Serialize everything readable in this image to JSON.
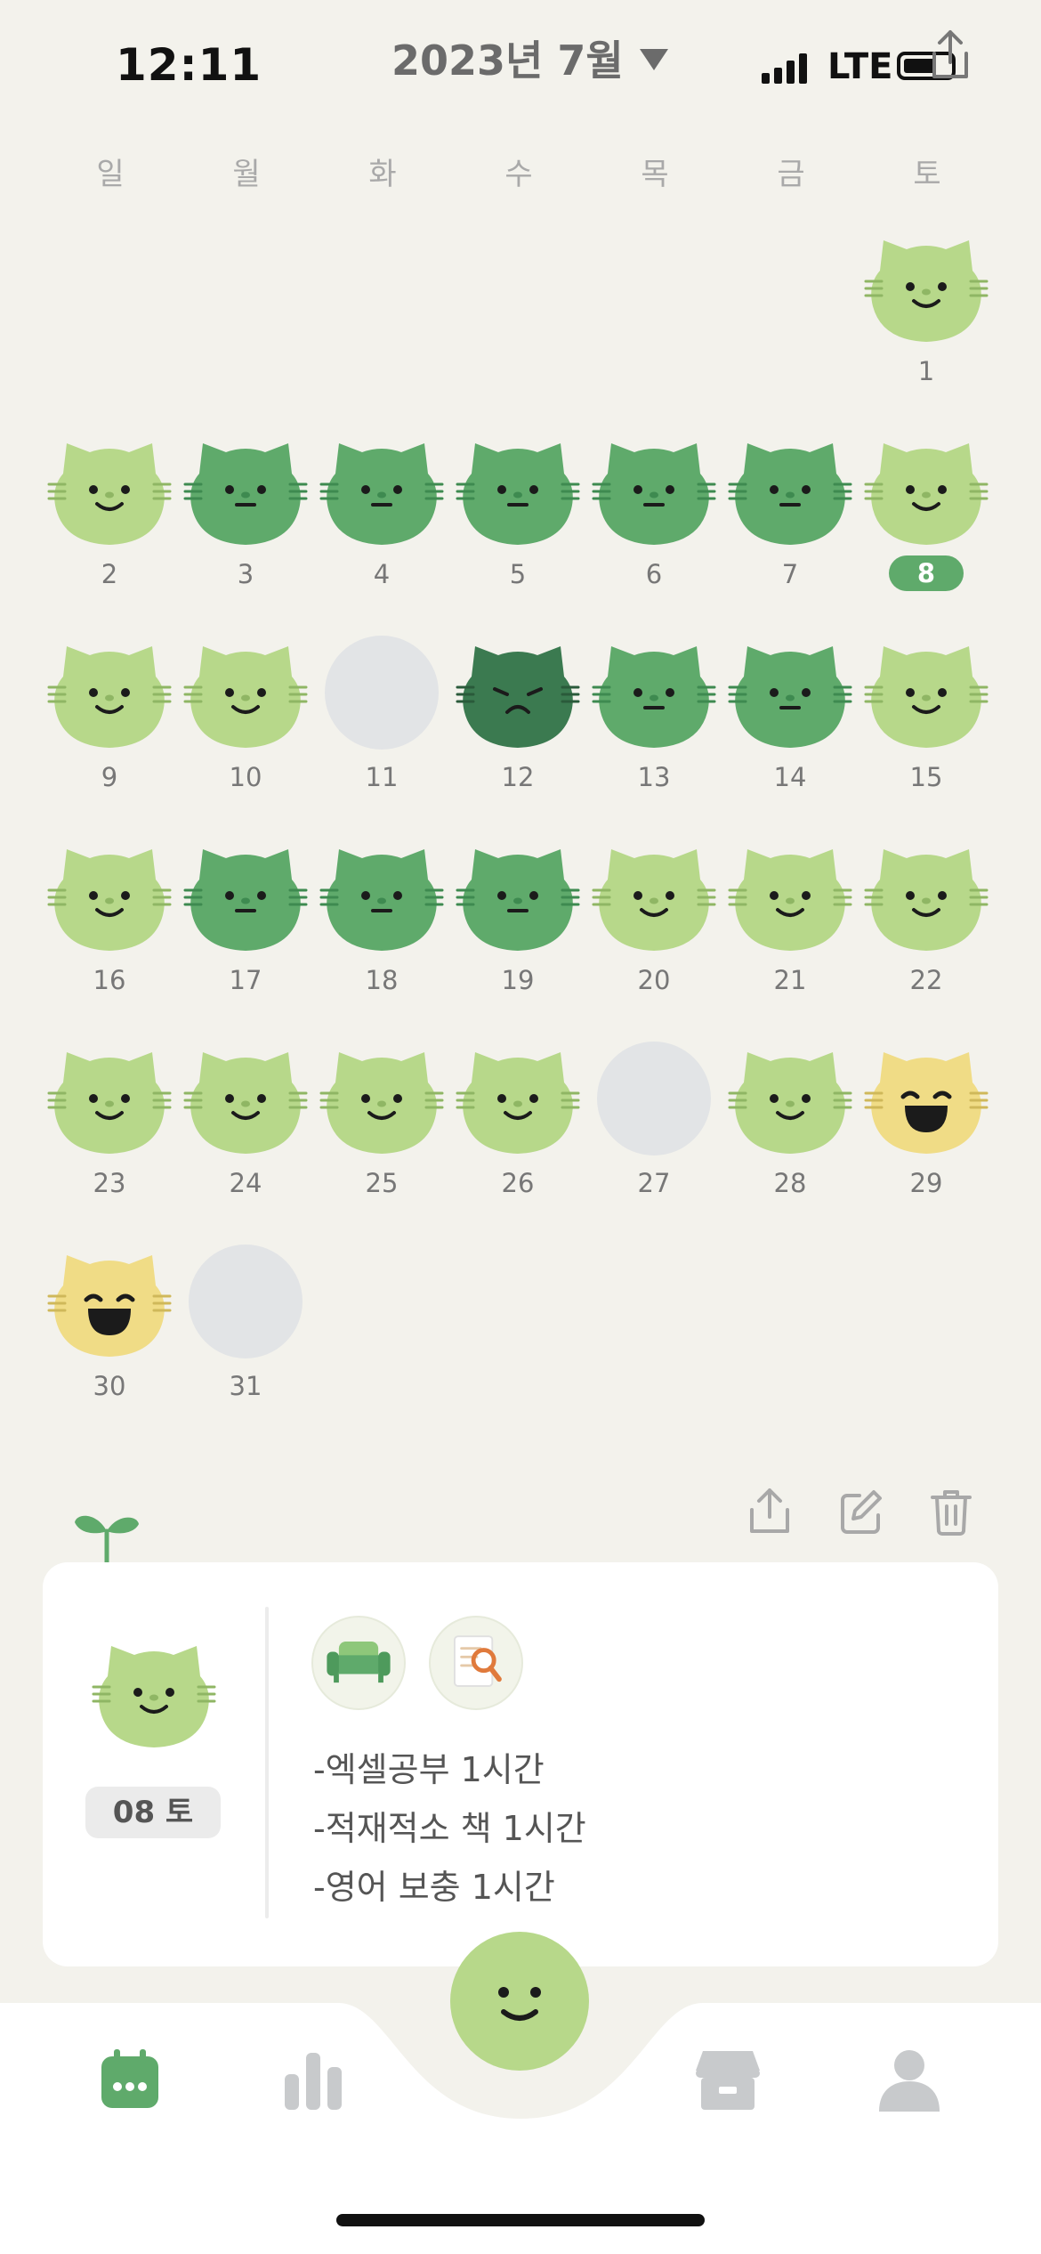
{
  "status": {
    "time": "12:11",
    "network": "LTE"
  },
  "header": {
    "month_title": "2023년 7월"
  },
  "weekdays": [
    "일",
    "월",
    "화",
    "수",
    "목",
    "금",
    "토"
  ],
  "days": [
    {
      "day": "1",
      "mood": "happy"
    },
    {
      "day": "2",
      "mood": "happy"
    },
    {
      "day": "3",
      "mood": "neutral"
    },
    {
      "day": "4",
      "mood": "neutral"
    },
    {
      "day": "5",
      "mood": "neutral"
    },
    {
      "day": "6",
      "mood": "neutral"
    },
    {
      "day": "7",
      "mood": "neutral"
    },
    {
      "day": "8",
      "mood": "happy",
      "selected": true
    },
    {
      "day": "9",
      "mood": "happy"
    },
    {
      "day": "10",
      "mood": "happy"
    },
    {
      "day": "11",
      "mood": "empty"
    },
    {
      "day": "12",
      "mood": "sad"
    },
    {
      "day": "13",
      "mood": "neutral"
    },
    {
      "day": "14",
      "mood": "neutral"
    },
    {
      "day": "15",
      "mood": "happy"
    },
    {
      "day": "16",
      "mood": "happy"
    },
    {
      "day": "17",
      "mood": "neutral"
    },
    {
      "day": "18",
      "mood": "neutral"
    },
    {
      "day": "19",
      "mood": "neutral"
    },
    {
      "day": "20",
      "mood": "happy"
    },
    {
      "day": "21",
      "mood": "happy"
    },
    {
      "day": "22",
      "mood": "happy"
    },
    {
      "day": "23",
      "mood": "happy"
    },
    {
      "day": "24",
      "mood": "happy"
    },
    {
      "day": "25",
      "mood": "happy"
    },
    {
      "day": "26",
      "mood": "happy"
    },
    {
      "day": "27",
      "mood": "empty"
    },
    {
      "day": "28",
      "mood": "happy"
    },
    {
      "day": "29",
      "mood": "joy"
    },
    {
      "day": "30",
      "mood": "joy"
    },
    {
      "day": "31",
      "mood": "empty"
    }
  ],
  "mood_colors": {
    "happy": "#b7d88a",
    "neutral": "#5faa6b",
    "sad": "#3b7a50",
    "joy": "#f0dc86",
    "empty": "#e2e4e6"
  },
  "selected_entry": {
    "date_label": "08 토",
    "mood": "happy",
    "activity_icons": [
      "sofa-icon",
      "document-search-icon"
    ],
    "notes": [
      "-엑셀공부 1시간",
      "-적재적소 책 1시간",
      "-영어 보충 1시간"
    ]
  },
  "tabbar": {
    "items": [
      "calendar-icon",
      "stats-icon",
      "add-mood-button",
      "store-icon",
      "profile-icon"
    ],
    "active": "calendar-icon",
    "accent": "#5faa6b"
  }
}
